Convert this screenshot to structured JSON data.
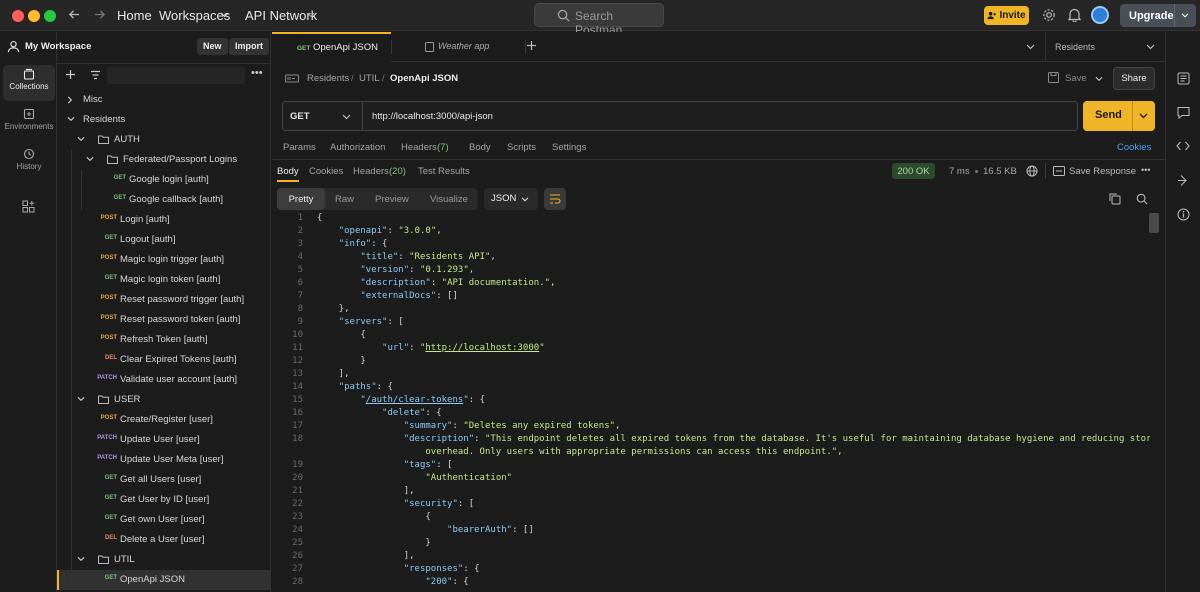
{
  "topbar": {
    "home": "Home",
    "workspaces": "Workspaces",
    "api_network": "API Network",
    "search_placeholder": "Search Postman",
    "invite": "Invite",
    "upgrade": "Upgrade"
  },
  "rail": {
    "items": [
      {
        "label": "Collections",
        "icon": "collections-icon"
      },
      {
        "label": "Environments",
        "icon": "environments-icon"
      },
      {
        "label": "History",
        "icon": "history-icon"
      }
    ]
  },
  "sidebar": {
    "workspace": "My Workspace",
    "new_btn": "New",
    "import_btn": "Import",
    "tree": [
      {
        "type": "folder",
        "label": "Misc",
        "depth": 0,
        "open": false
      },
      {
        "type": "folder",
        "label": "Residents",
        "depth": 0,
        "open": true
      },
      {
        "type": "dir",
        "label": "AUTH",
        "depth": 1,
        "open": true
      },
      {
        "type": "dir",
        "label": "Federated/Passport Logins",
        "depth": 2,
        "open": true
      },
      {
        "type": "req",
        "method": "GET",
        "label": "Google login [auth]",
        "depth": 3
      },
      {
        "type": "req",
        "method": "GET",
        "label": "Google callback [auth]",
        "depth": 3
      },
      {
        "type": "req",
        "method": "POST",
        "label": "Login [auth]",
        "depth": 2
      },
      {
        "type": "req",
        "method": "GET",
        "label": "Logout [auth]",
        "depth": 2
      },
      {
        "type": "req",
        "method": "POST",
        "label": "Magic login trigger [auth]",
        "depth": 2
      },
      {
        "type": "req",
        "method": "GET",
        "label": "Magic login token [auth]",
        "depth": 2
      },
      {
        "type": "req",
        "method": "POST",
        "label": "Reset password trigger [auth]",
        "depth": 2
      },
      {
        "type": "req",
        "method": "POST",
        "label": "Reset password token [auth]",
        "depth": 2
      },
      {
        "type": "req",
        "method": "POST",
        "label": "Refresh Token [auth]",
        "depth": 2
      },
      {
        "type": "req",
        "method": "DEL",
        "label": "Clear Expired Tokens [auth]",
        "depth": 2
      },
      {
        "type": "req",
        "method": "PATCH",
        "label": "Validate user account [auth]",
        "depth": 2
      },
      {
        "type": "dir",
        "label": "USER",
        "depth": 1,
        "open": true
      },
      {
        "type": "req",
        "method": "POST",
        "label": "Create/Register [user]",
        "depth": 2
      },
      {
        "type": "req",
        "method": "PATCH",
        "label": "Update User [user]",
        "depth": 2
      },
      {
        "type": "req",
        "method": "PATCH",
        "label": "Update User Meta [user]",
        "depth": 2
      },
      {
        "type": "req",
        "method": "GET",
        "label": "Get all Users [user]",
        "depth": 2
      },
      {
        "type": "req",
        "method": "GET",
        "label": "Get User by ID [user]",
        "depth": 2
      },
      {
        "type": "req",
        "method": "GET",
        "label": "Get own User [user]",
        "depth": 2
      },
      {
        "type": "req",
        "method": "DEL",
        "label": "Delete a User [user]",
        "depth": 2
      },
      {
        "type": "dir",
        "label": "UTIL",
        "depth": 1,
        "open": true
      },
      {
        "type": "req",
        "method": "GET",
        "label": "OpenApi JSON",
        "depth": 2,
        "selected": true
      }
    ]
  },
  "tabs": {
    "active_method": "GET",
    "active_label": "OpenApi JSON",
    "second_label": "Weather app",
    "env": "Residents"
  },
  "request": {
    "breadcrumb": [
      "Residents",
      "UTIL",
      "OpenApi JSON"
    ],
    "save": "Save",
    "share": "Share",
    "method": "GET",
    "url": "http://localhost:3000/api-json",
    "send": "Send",
    "subtabs": [
      "Params",
      "Authorization",
      "Headers",
      "Body",
      "Scripts",
      "Settings"
    ],
    "headers_count": "(7)",
    "cookies": "Cookies"
  },
  "response": {
    "tabs": [
      "Body",
      "Cookies",
      "Headers",
      "Test Results"
    ],
    "headers_count": "(20)",
    "status": "200 OK",
    "time": "7 ms",
    "size": "16.5 KB",
    "save_response": "Save Response",
    "view_modes": [
      "Pretty",
      "Raw",
      "Preview",
      "Visualize"
    ],
    "format": "JSON"
  },
  "code": [
    {
      "n": "1",
      "t": [
        [
          "p",
          "{"
        ]
      ]
    },
    {
      "n": "2",
      "t": [
        [
          "p",
          "    "
        ],
        [
          "k",
          "\"openapi\""
        ],
        [
          "p",
          ": "
        ],
        [
          "s",
          "\"3.0.0\""
        ],
        [
          "p",
          ","
        ]
      ]
    },
    {
      "n": "3",
      "t": [
        [
          "p",
          "    "
        ],
        [
          "k",
          "\"info\""
        ],
        [
          "p",
          ": {"
        ]
      ]
    },
    {
      "n": "4",
      "t": [
        [
          "p",
          "        "
        ],
        [
          "k",
          "\"title\""
        ],
        [
          "p",
          ": "
        ],
        [
          "s",
          "\"Residents API\""
        ],
        [
          "p",
          ","
        ]
      ]
    },
    {
      "n": "5",
      "t": [
        [
          "p",
          "        "
        ],
        [
          "k",
          "\"version\""
        ],
        [
          "p",
          ": "
        ],
        [
          "s",
          "\"0.1.293\""
        ],
        [
          "p",
          ","
        ]
      ]
    },
    {
      "n": "6",
      "t": [
        [
          "p",
          "        "
        ],
        [
          "k",
          "\"description\""
        ],
        [
          "p",
          ": "
        ],
        [
          "s",
          "\"API documentation.\""
        ],
        [
          "p",
          ","
        ]
      ]
    },
    {
      "n": "7",
      "t": [
        [
          "p",
          "        "
        ],
        [
          "k",
          "\"externalDocs\""
        ],
        [
          "p",
          ": []"
        ]
      ]
    },
    {
      "n": "8",
      "t": [
        [
          "p",
          "    },"
        ]
      ]
    },
    {
      "n": "9",
      "t": [
        [
          "p",
          "    "
        ],
        [
          "k",
          "\"servers\""
        ],
        [
          "p",
          ": ["
        ]
      ]
    },
    {
      "n": "10",
      "t": [
        [
          "p",
          "        {"
        ]
      ]
    },
    {
      "n": "11",
      "t": [
        [
          "p",
          "            "
        ],
        [
          "k",
          "\"url\""
        ],
        [
          "p",
          ": "
        ],
        [
          "s",
          "\""
        ],
        [
          "u",
          "http://localhost:3000"
        ],
        [
          "s",
          "\""
        ]
      ]
    },
    {
      "n": "12",
      "t": [
        [
          "p",
          "        }"
        ]
      ]
    },
    {
      "n": "13",
      "t": [
        [
          "p",
          "    ],"
        ]
      ]
    },
    {
      "n": "14",
      "t": [
        [
          "p",
          "    "
        ],
        [
          "k",
          "\"paths\""
        ],
        [
          "p",
          ": {"
        ]
      ]
    },
    {
      "n": "15",
      "t": [
        [
          "p",
          "        "
        ],
        [
          "k",
          "\""
        ],
        [
          "ku",
          "/auth/clear-tokens"
        ],
        [
          "k",
          "\""
        ],
        [
          "p",
          ": {"
        ]
      ]
    },
    {
      "n": "16",
      "t": [
        [
          "p",
          "            "
        ],
        [
          "k",
          "\"delete\""
        ],
        [
          "p",
          ": {"
        ]
      ]
    },
    {
      "n": "17",
      "t": [
        [
          "p",
          "                "
        ],
        [
          "k",
          "\"summary\""
        ],
        [
          "p",
          ": "
        ],
        [
          "s",
          "\"Deletes any expired tokens\""
        ],
        [
          "p",
          ","
        ]
      ]
    },
    {
      "n": "18",
      "t": [
        [
          "p",
          "                "
        ],
        [
          "k",
          "\"description\""
        ],
        [
          "p",
          ": "
        ],
        [
          "s",
          "\"This endpoint deletes all expired tokens from the database. It's useful for maintaining database hygiene and reducing storage"
        ]
      ]
    },
    {
      "n": "",
      "t": [
        [
          "s",
          "                    overhead. Only users with appropriate permissions can access this endpoint.\""
        ],
        [
          "p",
          ","
        ]
      ]
    },
    {
      "n": "19",
      "t": [
        [
          "p",
          "                "
        ],
        [
          "k",
          "\"tags\""
        ],
        [
          "p",
          ": ["
        ]
      ]
    },
    {
      "n": "20",
      "t": [
        [
          "p",
          "                    "
        ],
        [
          "s",
          "\"Authentication\""
        ]
      ]
    },
    {
      "n": "21",
      "t": [
        [
          "p",
          "                ],"
        ]
      ]
    },
    {
      "n": "22",
      "t": [
        [
          "p",
          "                "
        ],
        [
          "k",
          "\"security\""
        ],
        [
          "p",
          ": ["
        ]
      ]
    },
    {
      "n": "23",
      "t": [
        [
          "p",
          "                    {"
        ]
      ]
    },
    {
      "n": "24",
      "t": [
        [
          "p",
          "                        "
        ],
        [
          "k",
          "\"bearerAuth\""
        ],
        [
          "p",
          ": []"
        ]
      ]
    },
    {
      "n": "25",
      "t": [
        [
          "p",
          "                    }"
        ]
      ]
    },
    {
      "n": "26",
      "t": [
        [
          "p",
          "                ],"
        ]
      ]
    },
    {
      "n": "27",
      "t": [
        [
          "p",
          "                "
        ],
        [
          "k",
          "\"responses\""
        ],
        [
          "p",
          ": {"
        ]
      ]
    },
    {
      "n": "28",
      "t": [
        [
          "p",
          "                    "
        ],
        [
          "k",
          "\"200\""
        ],
        [
          "p",
          ": {"
        ]
      ]
    }
  ],
  "colors": {
    "accent": "#f0b429",
    "send": "#f0b429",
    "get": "#7ec27b",
    "post": "#e6a84d",
    "patch": "#b48ee6",
    "delete": "#e8896f",
    "status_ok": "#7ec27b"
  }
}
